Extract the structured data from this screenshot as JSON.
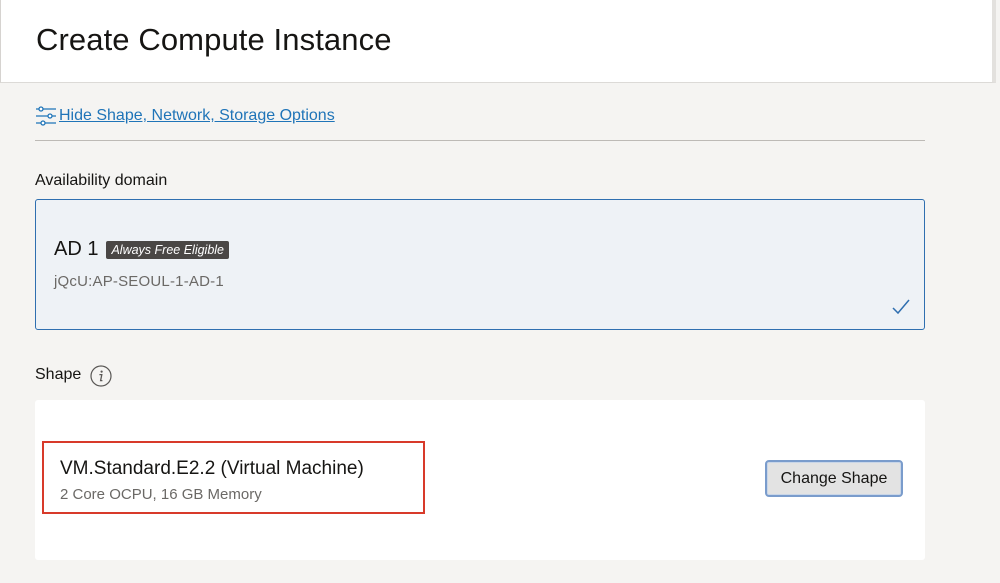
{
  "header": {
    "title": "Create Compute Instance"
  },
  "options_toggle": {
    "label": "Hide Shape, Network, Storage Options",
    "icon": "sliders-icon"
  },
  "availability_domain": {
    "label": "Availability domain",
    "selected": {
      "name": "AD 1",
      "badge": "Always Free Eligible",
      "id": "jQcU:AP-SEOUL-1-AD-1",
      "checked": true
    }
  },
  "shape": {
    "label": "Shape",
    "info_icon": "info-icon",
    "name": "VM.Standard.E2.2 (Virtual Machine)",
    "spec": "2 Core OCPU, 16 GB Memory",
    "change_button_label": "Change Shape"
  },
  "colors": {
    "link": "#1f74b8",
    "selected_border": "#2f6fb0",
    "highlight_box": "#d83a2a",
    "badge_bg": "#4a4745"
  }
}
